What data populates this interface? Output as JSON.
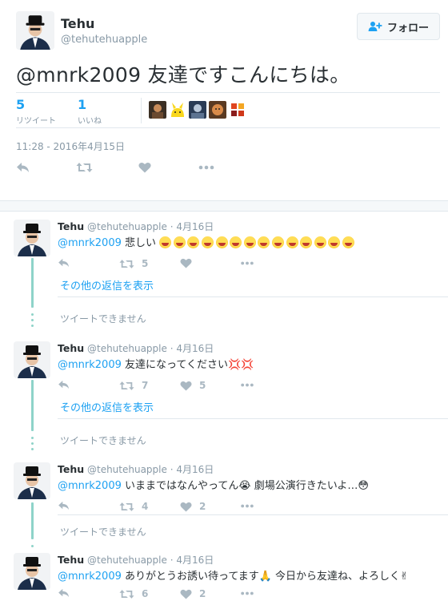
{
  "tweet": {
    "display_name": "Tehu",
    "screen_name": "@tehutehuapple",
    "follow_label": "フォロー",
    "text": "@mnrk2009 友達ですこんにちは。",
    "retweets": {
      "count": "5",
      "label": "リツイート"
    },
    "likes": {
      "count": "1",
      "label": "いいね"
    },
    "timestamp": "11:28 - 2016年4月15日"
  },
  "replies": [
    {
      "name": "Tehu",
      "handle": "@tehutehuapple",
      "date": "· 4月16日",
      "mention": "@mnrk2009",
      "text": "悲しい",
      "emoji_count": 14,
      "retweet_count": "5",
      "like_count": ""
    },
    {
      "name": "Tehu",
      "handle": "@tehutehuapple",
      "date": "· 4月16日",
      "mention": "@mnrk2009",
      "text": "友達になってください💢💢",
      "retweet_count": "7",
      "like_count": "5"
    },
    {
      "name": "Tehu",
      "handle": "@tehutehuapple",
      "date": "· 4月16日",
      "mention": "@mnrk2009",
      "text": "いままではなんやってん😭 劇場公演行きたいよ…😳",
      "retweet_count": "4",
      "like_count": "2"
    },
    {
      "name": "Tehu",
      "handle": "@tehutehuapple",
      "date": "· 4月16日",
      "mention": "@mnrk2009",
      "text": "ありがとうお誘い待ってます🙏 今日から友達ね、よろしく✌",
      "retweet_count": "6",
      "like_count": "2"
    }
  ],
  "show_more_label": "その他の返信を表示",
  "unavailable_label": "ツイートできません",
  "colors": {
    "accent": "#1da1f2",
    "thread": "#8ed3c9",
    "muted": "#8899a6",
    "icon": "#aab8c2"
  }
}
